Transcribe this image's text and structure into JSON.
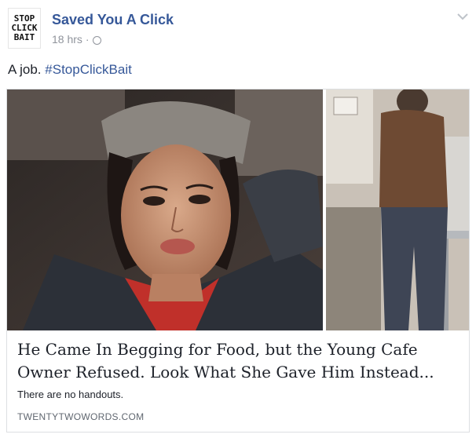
{
  "post": {
    "avatar_lines": [
      "STOP",
      "CLICK",
      "BAIT"
    ],
    "page_name": "Saved You A Click",
    "timestamp": "18 hrs",
    "separator": "·",
    "audience_icon": "globe-icon",
    "options_icon": "chevron-down-icon",
    "text_prefix": "A job.",
    "hashtag": "#StopClickBait"
  },
  "link_card": {
    "title": "He Came In Begging for Food, but the Young Cafe Owner Refused. Look What She Gave Him Instead...",
    "description": "There are no handouts.",
    "domain": "TWENTYTWOWORDS.COM"
  },
  "colors": {
    "link_blue": "#365899",
    "meta_gray": "#90949c",
    "text": "#1d2129",
    "border": "#dddfe2"
  }
}
